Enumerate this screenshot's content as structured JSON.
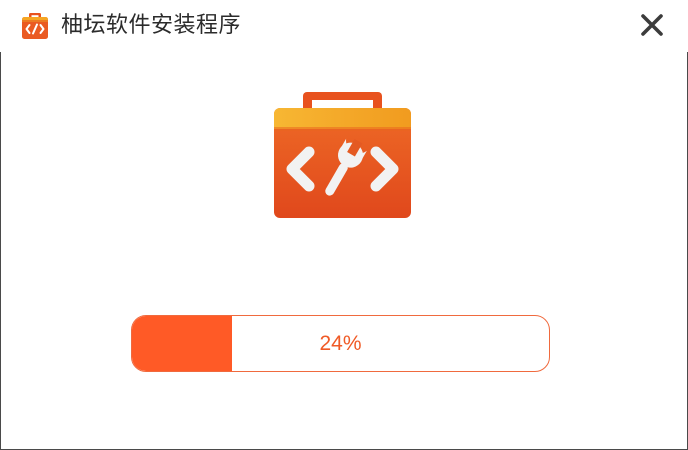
{
  "window": {
    "title": "柚坛软件安装程序"
  },
  "icons": {
    "app": "toolbox-code-icon",
    "close": "close-icon",
    "hero": "toolbox-code-icon"
  },
  "progress": {
    "percent": 24,
    "label": "24%"
  },
  "colors": {
    "accent": "#ff5a26",
    "accent_text": "#f05a26",
    "border": "#f06a3e",
    "toolbox_body": "#ea5a22",
    "toolbox_lid": "#f5a623",
    "glyph": "#ffffff",
    "title_text": "#2b2b2b"
  }
}
